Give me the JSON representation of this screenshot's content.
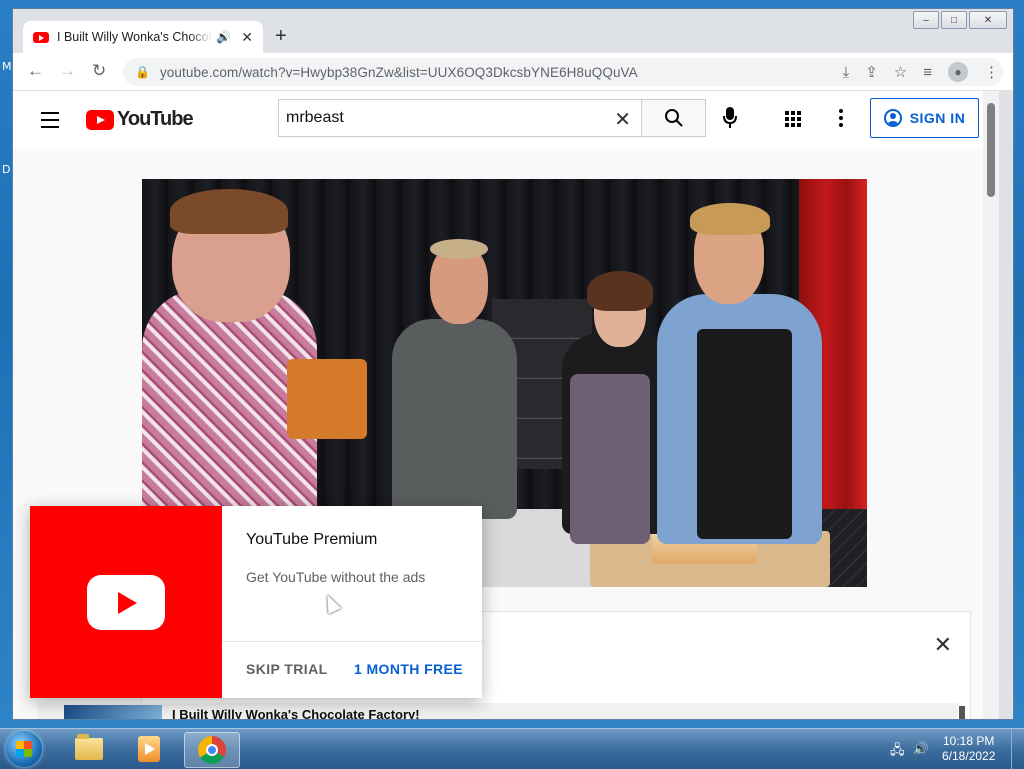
{
  "desktop": {
    "edge_letter_1": "M",
    "edge_letter_2": "D"
  },
  "browser": {
    "tab": {
      "title": "I Built Willy Wonka's Chocolate Factory!",
      "favicon": "youtube-icon"
    },
    "window_buttons": {
      "minimize": "–",
      "maximize": "□",
      "close": "✕"
    },
    "url": "youtube.com/watch?v=Hwybp38GnZw&list=UUX6OQ3DkcsbYNE6H8uQQuVA"
  },
  "youtube": {
    "logo_text": "YouTube",
    "search_value": "mrbeast",
    "sign_in": "SIGN IN"
  },
  "playlist": {
    "first_item_title": "I Built Willy Wonka's Chocolate Factory!"
  },
  "premium_popup": {
    "title": "YouTube Premium",
    "description": "Get YouTube without the ads",
    "skip": "SKIP TRIAL",
    "cta": "1 MONTH FREE"
  },
  "taskbar": {
    "time": "10:18 PM",
    "date": "6/18/2022",
    "pinned": [
      "folder-icon",
      "media-player-icon",
      "chrome-icon"
    ]
  },
  "colors": {
    "youtube_red": "#ff0000",
    "link_blue": "#065fd4"
  }
}
